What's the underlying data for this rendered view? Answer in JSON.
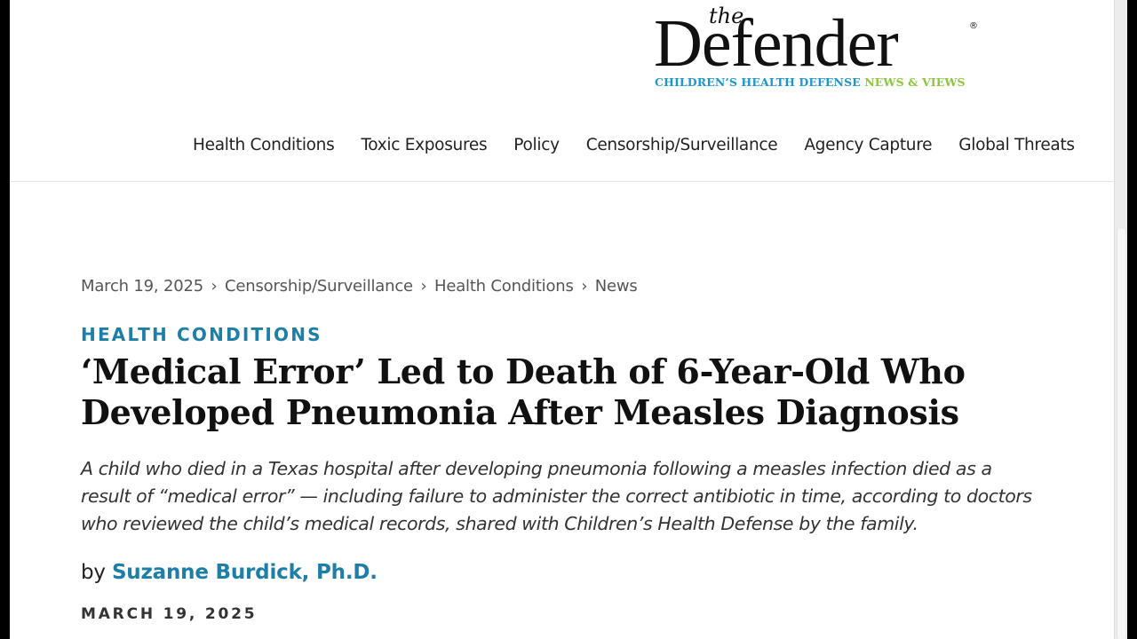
{
  "site": {
    "logo_the": "the",
    "logo_word": "Defender",
    "logo_reg": "®",
    "tagline_part1": "CHILDREN’S HEALTH DEFENSE",
    "tagline_part2": "NEWS & VIEWS",
    "tagline_colors": {
      "part1": "#1c97cf",
      "part2": "#8cc63f"
    }
  },
  "nav": {
    "items": [
      {
        "label": "Health Conditions"
      },
      {
        "label": "Toxic Exposures"
      },
      {
        "label": "Policy"
      },
      {
        "label": "Censorship/Surveillance"
      },
      {
        "label": "Agency Capture"
      },
      {
        "label": "Global Threats"
      }
    ]
  },
  "breadcrumb": {
    "date": "March 19, 2025",
    "separator": "›",
    "items": [
      "Censorship/Surveillance",
      "Health Conditions",
      "News"
    ]
  },
  "article": {
    "category": "HEALTH CONDITIONS",
    "title": "‘Medical Error’ Led to Death of 6-Year-Old Who Developed Pneumonia After Measles Diagnosis",
    "dek": "A child who died in a Texas hospital after developing pneumonia following a measles infection died as a result of “medical error” — including failure to administer the correct antibiotic in time, according to doctors who reviewed the child’s medical records, shared with Children’s Health Defense by the family.",
    "byline_prefix": "by",
    "author": "Suzanne Burdick, Ph.D.",
    "date": "MARCH 19, 2025",
    "accent_color": "#1d7fa8"
  }
}
